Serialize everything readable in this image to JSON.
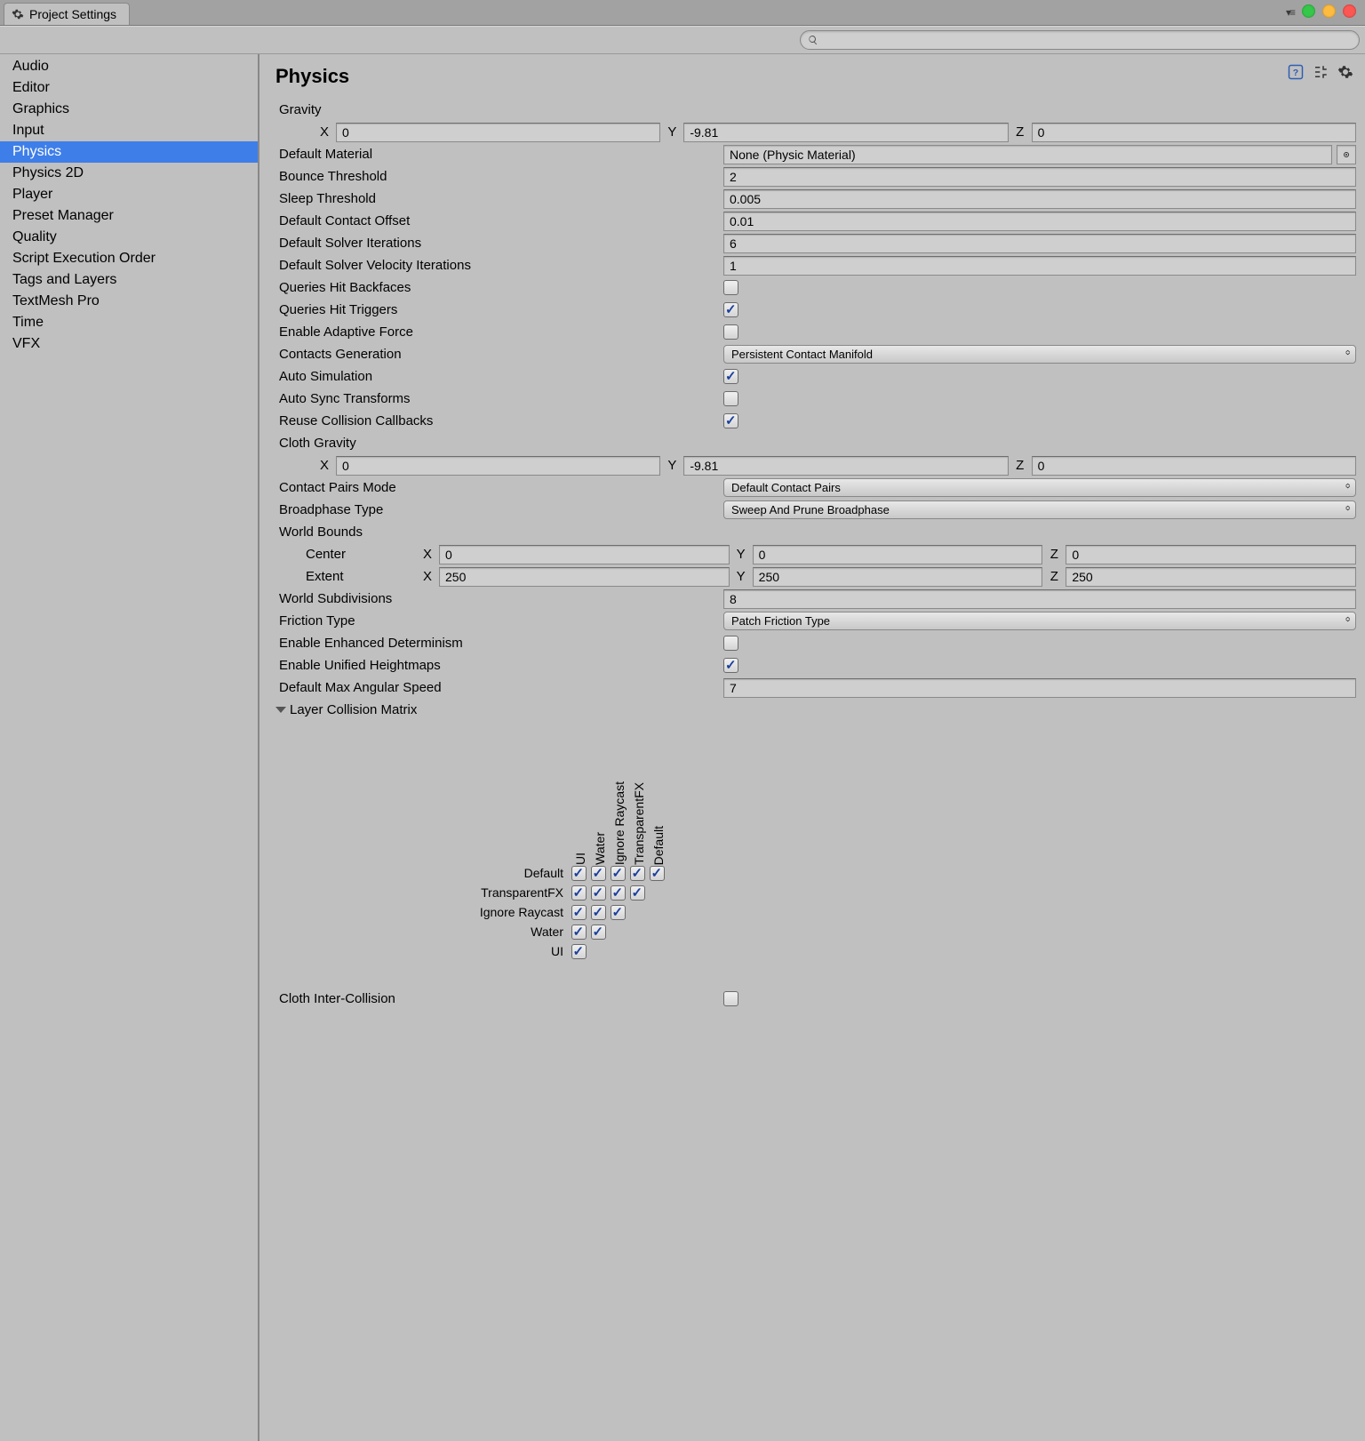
{
  "window": {
    "title": "Project Settings"
  },
  "sidebar": {
    "items": [
      {
        "label": "Audio"
      },
      {
        "label": "Editor"
      },
      {
        "label": "Graphics"
      },
      {
        "label": "Input"
      },
      {
        "label": "Physics",
        "active": true
      },
      {
        "label": "Physics 2D"
      },
      {
        "label": "Player"
      },
      {
        "label": "Preset Manager"
      },
      {
        "label": "Quality"
      },
      {
        "label": "Script Execution Order"
      },
      {
        "label": "Tags and Layers"
      },
      {
        "label": "TextMesh Pro"
      },
      {
        "label": "Time"
      },
      {
        "label": "VFX"
      }
    ]
  },
  "page": {
    "title": "Physics"
  },
  "labels": {
    "gravity": "Gravity",
    "default_material": "Default Material",
    "bounce_threshold": "Bounce Threshold",
    "sleep_threshold": "Sleep Threshold",
    "default_contact_offset": "Default Contact Offset",
    "default_solver_iterations": "Default Solver Iterations",
    "default_solver_velocity_iterations": "Default Solver Velocity Iterations",
    "queries_hit_backfaces": "Queries Hit Backfaces",
    "queries_hit_triggers": "Queries Hit Triggers",
    "enable_adaptive_force": "Enable Adaptive Force",
    "contacts_generation": "Contacts Generation",
    "auto_simulation": "Auto Simulation",
    "auto_sync_transforms": "Auto Sync Transforms",
    "reuse_collision_callbacks": "Reuse Collision Callbacks",
    "cloth_gravity": "Cloth Gravity",
    "contact_pairs_mode": "Contact Pairs Mode",
    "broadphase_type": "Broadphase Type",
    "world_bounds": "World Bounds",
    "center": "Center",
    "extent": "Extent",
    "world_subdivisions": "World Subdivisions",
    "friction_type": "Friction Type",
    "enable_enhanced_determinism": "Enable Enhanced Determinism",
    "enable_unified_heightmaps": "Enable Unified Heightmaps",
    "default_max_angular_speed": "Default Max Angular Speed",
    "layer_collision_matrix": "Layer Collision Matrix",
    "cloth_inter_collision": "Cloth Inter-Collision",
    "x": "X",
    "y": "Y",
    "z": "Z"
  },
  "values": {
    "gravity": {
      "x": "0",
      "y": "-9.81",
      "z": "0"
    },
    "default_material": "None (Physic Material)",
    "bounce_threshold": "2",
    "sleep_threshold": "0.005",
    "default_contact_offset": "0.01",
    "default_solver_iterations": "6",
    "default_solver_velocity_iterations": "1",
    "queries_hit_backfaces": false,
    "queries_hit_triggers": true,
    "enable_adaptive_force": false,
    "contacts_generation": "Persistent Contact Manifold",
    "auto_simulation": true,
    "auto_sync_transforms": false,
    "reuse_collision_callbacks": true,
    "cloth_gravity": {
      "x": "0",
      "y": "-9.81",
      "z": "0"
    },
    "contact_pairs_mode": "Default Contact Pairs",
    "broadphase_type": "Sweep And Prune Broadphase",
    "world_bounds": {
      "center": {
        "x": "0",
        "y": "0",
        "z": "0"
      },
      "extent": {
        "x": "250",
        "y": "250",
        "z": "250"
      }
    },
    "world_subdivisions": "8",
    "friction_type": "Patch Friction Type",
    "enable_enhanced_determinism": false,
    "enable_unified_heightmaps": true,
    "default_max_angular_speed": "7",
    "cloth_inter_collision": false
  },
  "matrix": {
    "layers": [
      "Default",
      "TransparentFX",
      "Ignore Raycast",
      "Water",
      "UI"
    ]
  }
}
